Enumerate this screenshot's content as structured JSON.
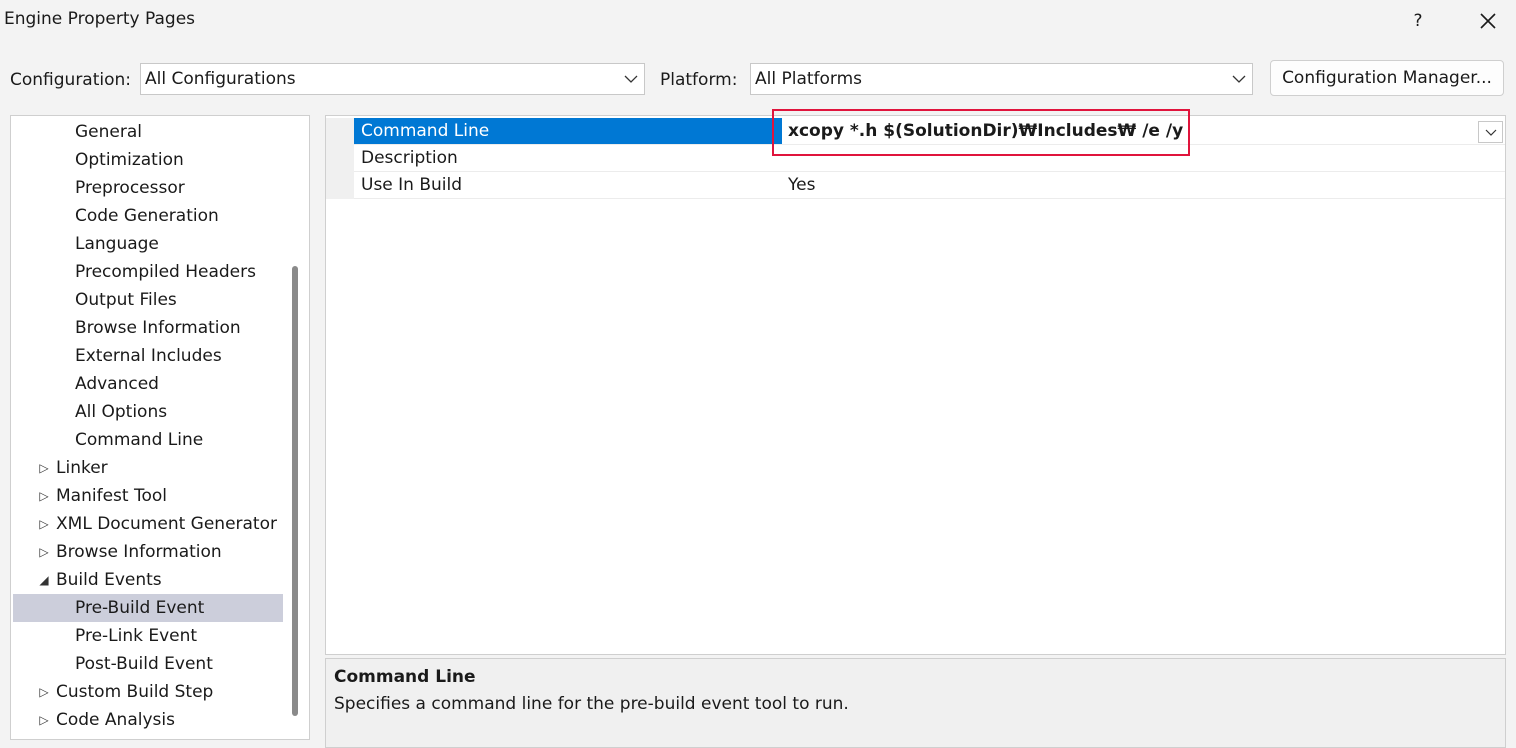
{
  "window": {
    "title": "Engine Property Pages",
    "help_label": "?"
  },
  "config": {
    "configuration_label": "Configuration:",
    "configuration_value": "All Configurations",
    "platform_label": "Platform:",
    "platform_value": "All Platforms",
    "manager_button": "Configuration Manager..."
  },
  "tree": {
    "items": [
      {
        "label": "General",
        "level": 2
      },
      {
        "label": "Optimization",
        "level": 2
      },
      {
        "label": "Preprocessor",
        "level": 2
      },
      {
        "label": "Code Generation",
        "level": 2
      },
      {
        "label": "Language",
        "level": 2
      },
      {
        "label": "Precompiled Headers",
        "level": 2
      },
      {
        "label": "Output Files",
        "level": 2
      },
      {
        "label": "Browse Information",
        "level": 2
      },
      {
        "label": "External Includes",
        "level": 2
      },
      {
        "label": "Advanced",
        "level": 2
      },
      {
        "label": "All Options",
        "level": 2
      },
      {
        "label": "Command Line",
        "level": 2
      },
      {
        "label": "Linker",
        "level": 1,
        "expander": "collapsed"
      },
      {
        "label": "Manifest Tool",
        "level": 1,
        "expander": "collapsed"
      },
      {
        "label": "XML Document Generator",
        "level": 1,
        "expander": "collapsed"
      },
      {
        "label": "Browse Information",
        "level": 1,
        "expander": "collapsed"
      },
      {
        "label": "Build Events",
        "level": 1,
        "expander": "expanded"
      },
      {
        "label": "Pre-Build Event",
        "level": 2,
        "selected": true
      },
      {
        "label": "Pre-Link Event",
        "level": 2
      },
      {
        "label": "Post-Build Event",
        "level": 2
      },
      {
        "label": "Custom Build Step",
        "level": 1,
        "expander": "collapsed"
      },
      {
        "label": "Code Analysis",
        "level": 1,
        "expander": "collapsed"
      }
    ]
  },
  "grid": {
    "rows": [
      {
        "name": "Command Line",
        "value": "xcopy *.h $(SolutionDir)₩Includes₩ /e /y",
        "selected": true
      },
      {
        "name": "Description",
        "value": ""
      },
      {
        "name": "Use In Build",
        "value": "Yes"
      }
    ]
  },
  "description": {
    "title": "Command Line",
    "text": "Specifies a command line for the pre-build event tool to run."
  },
  "colors": {
    "selection_blue": "#0078d4",
    "tree_selection": "#cccedb",
    "highlight_red": "#e0143c"
  }
}
